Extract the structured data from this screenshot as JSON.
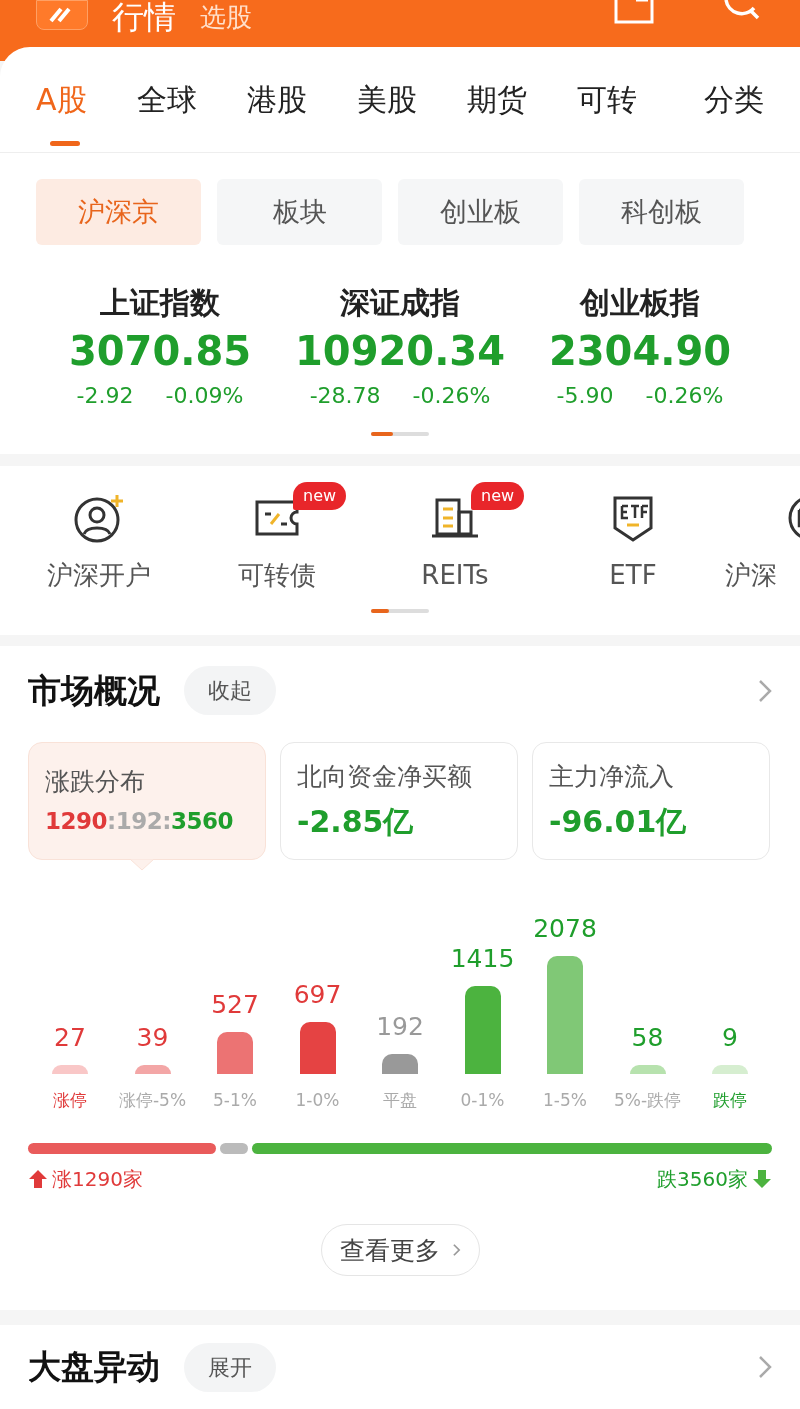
{
  "header": {
    "title": "行情",
    "subtitle": "选股"
  },
  "market_tabs": [
    {
      "label": "A股",
      "selected": true
    },
    {
      "label": "全球",
      "selected": false
    },
    {
      "label": "港股",
      "selected": false
    },
    {
      "label": "美股",
      "selected": false
    },
    {
      "label": "期货",
      "selected": false
    },
    {
      "label": "可转",
      "selected": false
    }
  ],
  "category_button": "分类",
  "sub_tabs": [
    {
      "label": "沪深京",
      "selected": true
    },
    {
      "label": "板块",
      "selected": false
    },
    {
      "label": "创业板",
      "selected": false
    },
    {
      "label": "科创板",
      "selected": false
    }
  ],
  "indices": [
    {
      "name": "上证指数",
      "value": "3070.85",
      "change": "-2.92",
      "percent": "-0.09%"
    },
    {
      "name": "深证成指",
      "value": "10920.34",
      "change": "-28.78",
      "percent": "-0.26%"
    },
    {
      "name": "创业板指",
      "value": "2304.90",
      "change": "-5.90",
      "percent": "-0.26%"
    }
  ],
  "shortcuts": [
    {
      "kind": "account",
      "label": "沪深开户"
    },
    {
      "kind": "bond",
      "label": "可转债",
      "badge": "new"
    },
    {
      "kind": "building",
      "label": "REITs",
      "badge": "new"
    },
    {
      "kind": "etf",
      "label": "ETF"
    },
    {
      "kind": "etf_round",
      "label": "沪深"
    }
  ],
  "market_overview": {
    "title": "市场概况",
    "toggle": "收起",
    "cards": [
      {
        "kind": "ratio",
        "title": "涨跌分布",
        "up": "1290",
        "sep1": ":",
        "flat": "192",
        "sep2": ":",
        "down": "3560",
        "selected": true
      },
      {
        "kind": "amount",
        "title": "北向资金净买额",
        "value": "-2.85亿",
        "selected": false
      },
      {
        "kind": "amount",
        "title": "主力净流入",
        "value": "-96.01亿",
        "selected": false
      }
    ],
    "bars": [
      {
        "value": "27",
        "label": "涨停",
        "kind": "up",
        "limit": true,
        "color": "#f9c7c7"
      },
      {
        "value": "39",
        "label": "涨停-5%",
        "kind": "up",
        "limit": false,
        "color": "#f3a6a6"
      },
      {
        "value": "527",
        "label": "5-1%",
        "kind": "up",
        "limit": false,
        "color": "#ec7373"
      },
      {
        "value": "697",
        "label": "1-0%",
        "kind": "up",
        "limit": false,
        "color": "#e54343"
      },
      {
        "value": "192",
        "label": "平盘",
        "kind": "flat",
        "limit": false,
        "color": "#999999"
      },
      {
        "value": "1415",
        "label": "0-1%",
        "kind": "down",
        "limit": false,
        "color": "#4cb33f"
      },
      {
        "value": "2078",
        "label": "1-5%",
        "kind": "down",
        "limit": false,
        "color": "#80c876"
      },
      {
        "value": "58",
        "label": "5%-跌停",
        "kind": "down",
        "limit": false,
        "color": "#b7e2ae"
      },
      {
        "value": "9",
        "label": "跌停",
        "kind": "down",
        "limit": true,
        "color": "#d6eed0"
      }
    ],
    "up_total": "涨1290家",
    "down_total": "跌3560家",
    "more": "查看更多"
  },
  "market_moves": {
    "title": "大盘异动",
    "toggle": "展开"
  }
}
